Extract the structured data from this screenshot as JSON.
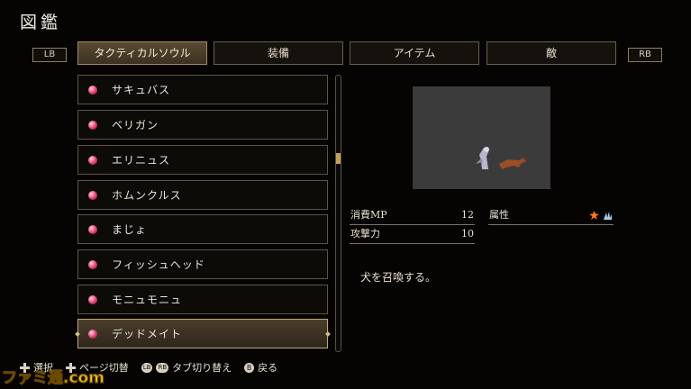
{
  "header": {
    "title": "図鑑"
  },
  "shoulders": {
    "left": "LB",
    "right": "RB"
  },
  "tabs": [
    {
      "label": "タクティカルソウル",
      "active": true
    },
    {
      "label": "装備",
      "active": false
    },
    {
      "label": "アイテム",
      "active": false
    },
    {
      "label": "敵",
      "active": false
    }
  ],
  "list": {
    "items": [
      {
        "label": "サキュバス"
      },
      {
        "label": "ベリガン"
      },
      {
        "label": "エリニュス"
      },
      {
        "label": "ホムンクルス"
      },
      {
        "label": "まじょ"
      },
      {
        "label": "フィッシュヘッド"
      },
      {
        "label": "モニュモニュ"
      },
      {
        "label": "デッドメイト"
      }
    ],
    "selected_index": 7
  },
  "detail": {
    "stats": [
      {
        "key": "消費MP",
        "value": "12"
      },
      {
        "key": "攻撃力",
        "value": "10"
      }
    ],
    "attribute": {
      "key": "属性",
      "icons": [
        "fire-icon",
        "ice-icon"
      ]
    },
    "description": "犬を召喚する。"
  },
  "footer": {
    "select": "選択",
    "page_switch": "ページ切替",
    "lb": "LB",
    "rb": "RB",
    "tab_switch": "タブ切り替え",
    "b": "B",
    "back": "戻る"
  },
  "watermark": {
    "text": "ファミ通.com"
  },
  "colors": {
    "accent": "#c59e57",
    "gem": "#e03a6a",
    "preview_bg": "#3b3b3b"
  }
}
